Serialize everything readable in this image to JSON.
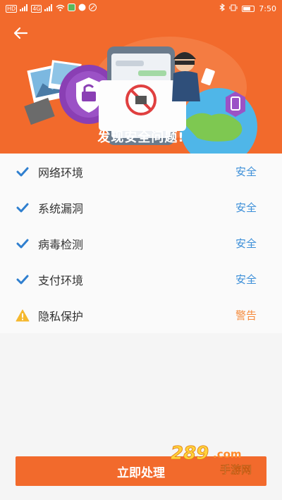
{
  "status_bar": {
    "left_chips": [
      "HD",
      "4G",
      "HD"
    ],
    "time": "7:50"
  },
  "header": {
    "back_icon": "back-arrow-icon",
    "title": "发现安全问题!"
  },
  "checks": [
    {
      "label": "网络环境",
      "status": "安全",
      "icon": "check-icon",
      "level": "ok"
    },
    {
      "label": "系统漏洞",
      "status": "安全",
      "icon": "check-icon",
      "level": "ok"
    },
    {
      "label": "病毒检测",
      "status": "安全",
      "icon": "check-icon",
      "level": "ok"
    },
    {
      "label": "支付环境",
      "status": "安全",
      "icon": "check-icon",
      "level": "ok"
    },
    {
      "label": "隐私保护",
      "status": "警告",
      "icon": "warning-icon",
      "level": "warn"
    }
  ],
  "action": {
    "label": "立即处理"
  },
  "watermark": {
    "text_number": "289",
    "text_suffix": ".com",
    "text_cn": "手游网"
  },
  "colors": {
    "brand": "#f26a2c",
    "safe": "#3b8ed8",
    "warning": "#f5893a"
  }
}
